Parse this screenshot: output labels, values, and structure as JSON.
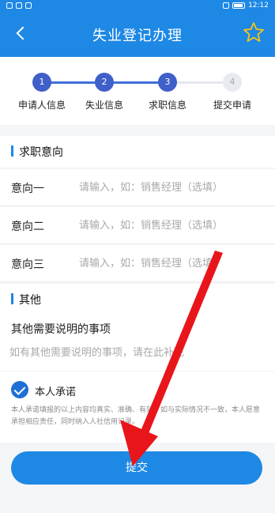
{
  "status_bar": {
    "time": "12:12"
  },
  "header": {
    "title": "失业登记办理",
    "back_icon": "back-arrow-icon",
    "star_icon": "star-outline-icon"
  },
  "steps": [
    {
      "number": "1",
      "label": "申请人信息",
      "active": true
    },
    {
      "number": "2",
      "label": "失业信息",
      "active": true
    },
    {
      "number": "3",
      "label": "求职信息",
      "active": true
    },
    {
      "number": "4",
      "label": "提交申请",
      "active": false
    }
  ],
  "job_intention": {
    "section_title": "求职意向",
    "rows": [
      {
        "label": "意向一",
        "placeholder": "请输入，如：销售经理（选填）",
        "value": ""
      },
      {
        "label": "意向二",
        "placeholder": "请输入，如：销售经理（选填）",
        "value": ""
      },
      {
        "label": "意向三",
        "placeholder": "请输入，如：销售经理（选填）",
        "value": ""
      }
    ]
  },
  "other": {
    "section_title": "其他",
    "subtitle": "其他需要说明的事项",
    "placeholder": "如有其他需要说明的事项，请在此补充",
    "value": ""
  },
  "promise": {
    "checked": true,
    "title": "本人承诺",
    "text": "本人承诺填报的以上内容均真实、准确、有效，如与实际情况不一致，本人愿意承担相应责任，同时纳入人社信用记录。"
  },
  "submit_label": "提交",
  "colors": {
    "primary": "#1e88e5",
    "step_active": "#3f5fc9",
    "annotation_arrow": "#e8161b"
  }
}
